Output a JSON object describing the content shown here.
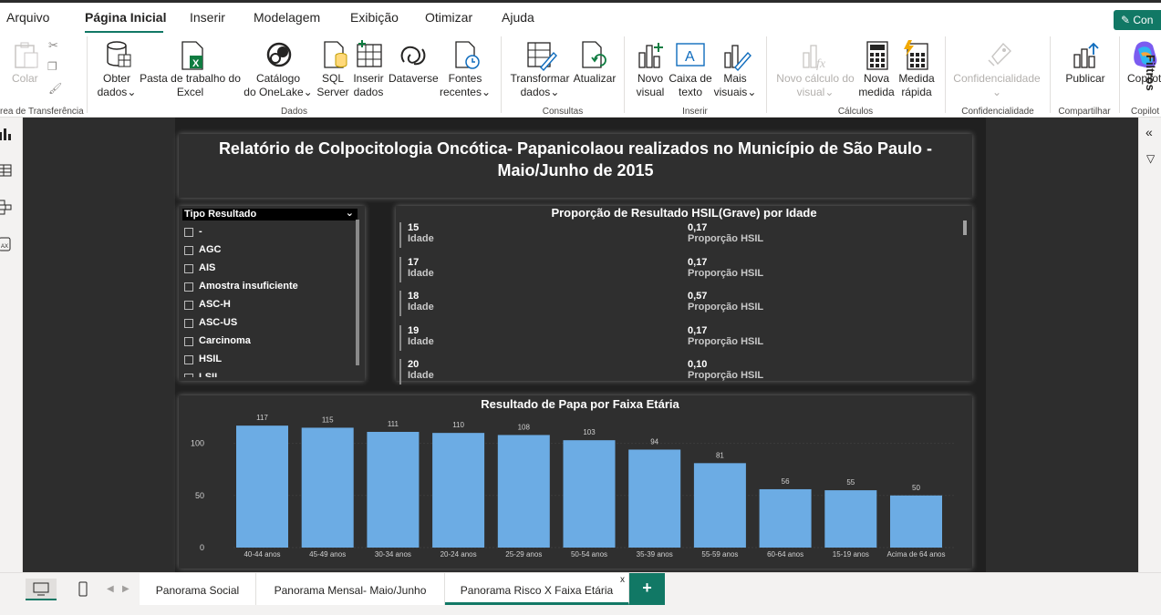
{
  "menu": {
    "tabs": [
      "Arquivo",
      "Página Inicial",
      "Inserir",
      "Modelagem",
      "Exibição",
      "Otimizar",
      "Ajuda"
    ],
    "share_label": "Con"
  },
  "ribbon": {
    "colar": "Colar",
    "clipboard_group": "rea de Transferência",
    "obter_dados": [
      "Obter",
      "dados"
    ],
    "excel": [
      "Pasta de trabalho do",
      "Excel"
    ],
    "onelake": [
      "Catálogo",
      "do OneLake"
    ],
    "sql": [
      "SQL",
      "Server"
    ],
    "inserir_dados": [
      "Inserir",
      "dados"
    ],
    "dataverse": "Dataverse",
    "fontes": [
      "Fontes",
      "recentes"
    ],
    "dados_group": "Dados",
    "transformar": [
      "Transformar",
      "dados"
    ],
    "atualizar": "Atualizar",
    "consultas_group": "Consultas",
    "novo_visual": [
      "Novo",
      "visual"
    ],
    "caixa_texto": [
      "Caixa de",
      "texto"
    ],
    "mais_visuais": [
      "Mais",
      "visuais"
    ],
    "inserir_group": "Inserir",
    "novo_calculo": [
      "Novo cálculo do",
      "visual"
    ],
    "nova_medida": [
      "Nova",
      "medida"
    ],
    "medida_rapida": [
      "Medida",
      "rápida"
    ],
    "calculos_group": "Cálculos",
    "confidencialidade": "Confidencialidade",
    "confidencialidade_group": "Confidencialidade",
    "publicar": "Publicar",
    "compartilhar_group": "Compartilhar",
    "copilot": "Copilot",
    "copilot_group": "Copilot"
  },
  "report": {
    "title": "Relatório de Colpocitologia Oncótica- Papanicolaou realizados no Município de São Paulo   - Maio/Junho de 2015"
  },
  "slicer": {
    "header": "Tipo Resultado",
    "items": [
      "-",
      "AGC",
      "AIS",
      "Amostra insuficiente",
      "ASC-H",
      "ASC-US",
      "Carcinoma",
      "HSIL",
      "LSIL"
    ]
  },
  "multirow": {
    "title": "Proporção de Resultado HSIL(Grave) por Idade",
    "label1": "Idade",
    "label2": "Proporção HSIL",
    "rows": [
      {
        "idade": "15",
        "prop": "0,17"
      },
      {
        "idade": "17",
        "prop": "0,17"
      },
      {
        "idade": "18",
        "prop": "0,57"
      },
      {
        "idade": "19",
        "prop": "0,17"
      },
      {
        "idade": "20",
        "prop": "0,10"
      }
    ]
  },
  "chart_data": {
    "type": "bar",
    "title": "Resultado de Papa por Faixa Etária",
    "categories": [
      "40-44 anos",
      "45-49 anos",
      "30-34 anos",
      "20-24 anos",
      "25-29 anos",
      "50-54 anos",
      "35-39 anos",
      "55-59 anos",
      "60-64 anos",
      "15-19 anos",
      "Acima de 64 anos"
    ],
    "values": [
      117,
      115,
      111,
      110,
      108,
      103,
      94,
      81,
      56,
      55,
      50
    ],
    "ylim": [
      0,
      125
    ],
    "yticks": [
      0,
      50,
      100
    ],
    "bar_color": "#6cace4",
    "grid": true
  },
  "right_panel": {
    "filtros": "Filtros"
  },
  "pages": {
    "tabs": [
      "Panorama Social",
      "Panorama Mensal- Maio/Junho",
      "Panorama Risco X Faixa Etária"
    ],
    "active": 2,
    "close": "x",
    "add": "+"
  },
  "colors": {
    "accent": "#117865",
    "canvas": "#2d2d2d",
    "report_bg": "#202020"
  }
}
